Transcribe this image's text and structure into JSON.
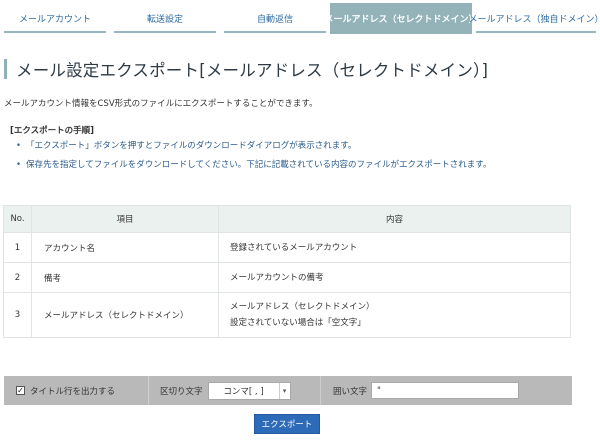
{
  "tabs": [
    {
      "label": "メールアカウント",
      "active": false
    },
    {
      "label": "転送設定",
      "active": false
    },
    {
      "label": "自動返信",
      "active": false
    },
    {
      "label": "メールアドレス（セレクトドメイン）",
      "active": true
    },
    {
      "label": "メールアドレス（独自ドメイン）",
      "active": false
    }
  ],
  "page": {
    "title": "メール設定エクスポート[メールアドレス（セレクトドメイン）]",
    "description": "メールアカウント情報をCSV形式のファイルにエクスポートすることができます。"
  },
  "steps": {
    "title": "[エクスポートの手順]",
    "bullet": "•",
    "items": [
      "「エクスポート」ボタンを押すとファイルのダウンロードダイアログが表示されます。",
      "保存先を指定してファイルをダウンロードしてください。下記に記載されている内容のファイルがエクスポートされます。"
    ]
  },
  "table": {
    "headers": {
      "no": "No.",
      "item": "項目",
      "content": "内容"
    },
    "rows": [
      {
        "no": "1",
        "item": "アカウント名",
        "content": [
          "登録されているメールアカウント"
        ]
      },
      {
        "no": "2",
        "item": "備考",
        "content": [
          "メールアカウントの備考"
        ]
      },
      {
        "no": "3",
        "item": "メールアドレス（セレクトドメイン）",
        "content": [
          "メールアドレス（セレクトドメイン）",
          "設定されていない場合は「空文字」"
        ]
      }
    ]
  },
  "export_bar": {
    "title_row_label": "タイトル行を出力する",
    "title_row_checked": true,
    "check_mark": "✓",
    "delimiter_label": "区切り文字",
    "delimiter_value": "コンマ[ , ]",
    "delimiter_arrow": "▾",
    "quote_label": "囲い文字",
    "quote_value": "\""
  },
  "export_button": "エクスポート"
}
